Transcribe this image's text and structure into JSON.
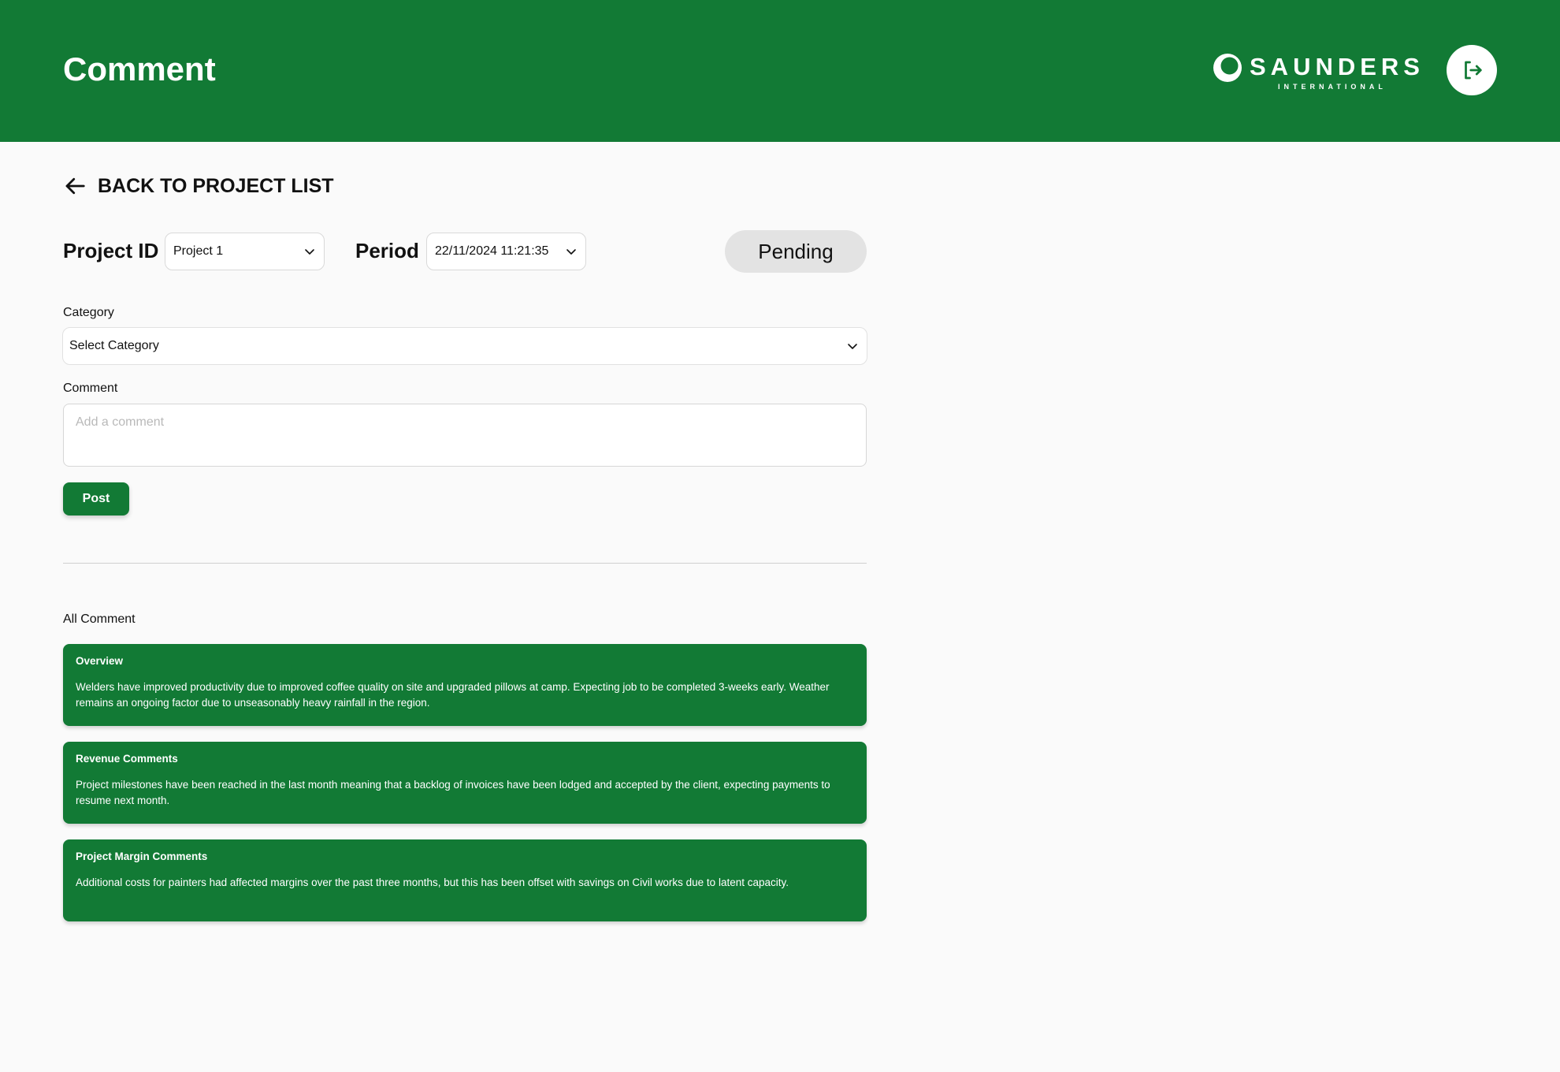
{
  "header": {
    "title": "Comment",
    "logo_name": "SAUNDERS",
    "logo_sub": "INTERNATIONAL",
    "logout_icon": "logout-icon"
  },
  "nav": {
    "back_label": "BACK TO PROJECT LIST",
    "back_icon": "arrow-left-icon"
  },
  "filters": {
    "project_label": "Project ID",
    "project_value": "Project 1",
    "period_label": "Period",
    "period_value": "22/11/2024 11:21:35",
    "status": "Pending"
  },
  "form": {
    "category_label": "Category",
    "category_value": "Select Category",
    "comment_label": "Comment",
    "comment_placeholder": "Add a comment",
    "post_label": "Post"
  },
  "comments": {
    "title": "All Comment",
    "items": [
      {
        "title": "Overview",
        "body": "Welders have improved productivity due to improved coffee quality on site and upgraded pillows at camp. Expecting job to be completed 3-weeks early. Weather remains an ongoing factor due to unseasonably heavy rainfall in the region."
      },
      {
        "title": "Revenue Comments",
        "body": "Project milestones have been reached in the last month meaning that a backlog of invoices have been lodged and accepted by the client, expecting payments to resume next month."
      },
      {
        "title": "Project Margin Comments",
        "body": "Additional costs for painters had affected margins over the past three months, but this has been offset with savings on Civil works due to latent capacity."
      }
    ]
  },
  "colors": {
    "brand_green": "#127a35",
    "background": "#fafafa",
    "status_bg": "#e3e3e3"
  }
}
